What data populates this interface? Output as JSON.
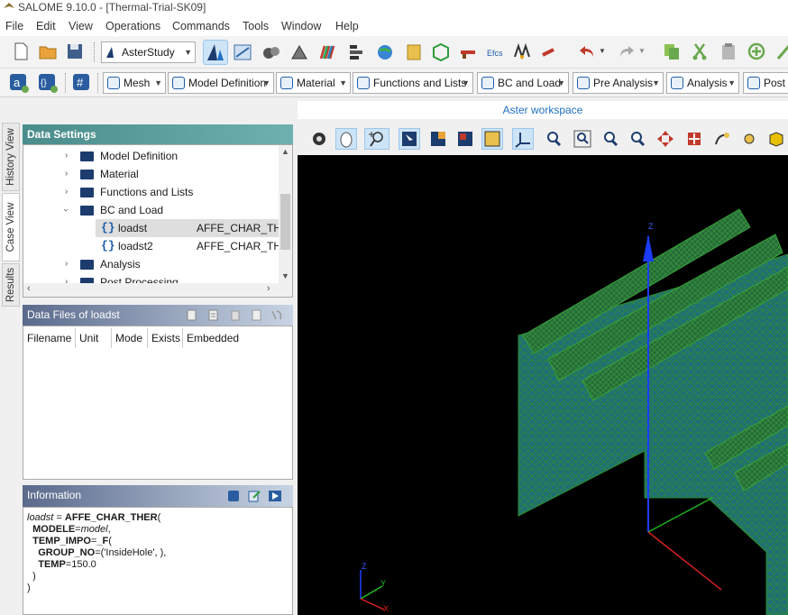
{
  "window": {
    "title": "SALOME 9.10.0 - [Thermal-Trial-SK09]"
  },
  "menu": [
    "File",
    "Edit",
    "View",
    "Operations",
    "Commands",
    "Tools",
    "Window",
    "Help"
  ],
  "toolbar": {
    "module_combo": "AsterStudy"
  },
  "categories": [
    {
      "label": "Mesh"
    },
    {
      "label": "Model Definition"
    },
    {
      "label": "Material"
    },
    {
      "label": "Functions and Lists"
    },
    {
      "label": "BC and Load"
    },
    {
      "label": "Pre Analysis"
    },
    {
      "label": "Analysis"
    },
    {
      "label": "Post P"
    }
  ],
  "side_tabs": [
    "History View",
    "Case View",
    "Results"
  ],
  "data_settings": {
    "title": "Data Settings",
    "tree": [
      {
        "label": "Model Definition"
      },
      {
        "label": "Material"
      },
      {
        "label": "Functions and Lists"
      },
      {
        "label": "BC and Load"
      },
      {
        "label": "loadst",
        "type": "AFFE_CHAR_TH..."
      },
      {
        "label": "loadst2",
        "type": "AFFE_CHAR_TH..."
      },
      {
        "label": "Analysis"
      },
      {
        "label": "Post Processing"
      }
    ]
  },
  "data_files": {
    "title": "Data Files of loadst",
    "columns": [
      "Filename",
      "Unit",
      "Mode",
      "Exists",
      "Embedded"
    ]
  },
  "information": {
    "title": "Information",
    "lines": [
      {
        "a": "loadst",
        "b": " = ",
        "c": "AFFE_CHAR_THER",
        "d": "("
      },
      {
        "a": "  MODELE",
        "b": "=",
        "c": "model",
        "d": ","
      },
      {
        "a": "  TEMP_IMPO",
        "b": "=",
        "c": "_F",
        "d": "("
      },
      {
        "a": "    GROUP_NO",
        "b": "=",
        "c": "('InsideHole', )",
        "d": ","
      },
      {
        "a": "    TEMP",
        "b": "=",
        "c": "150.0",
        "d": ""
      },
      {
        "a": "  )",
        "b": "",
        "c": "",
        "d": ""
      },
      {
        "a": ")",
        "b": "",
        "c": "",
        "d": ""
      }
    ]
  },
  "workspace": {
    "label": "Aster workspace"
  },
  "axes": {
    "main_z": "Z",
    "tri_z": "Z",
    "tri_y": "Y",
    "tri_x": "X"
  },
  "colors": {
    "mesh_fill": "#1f6f6f",
    "mesh_line": "#2e8b2e",
    "accent": "#1f6fc4",
    "panel_head": "#4a8c8c"
  }
}
